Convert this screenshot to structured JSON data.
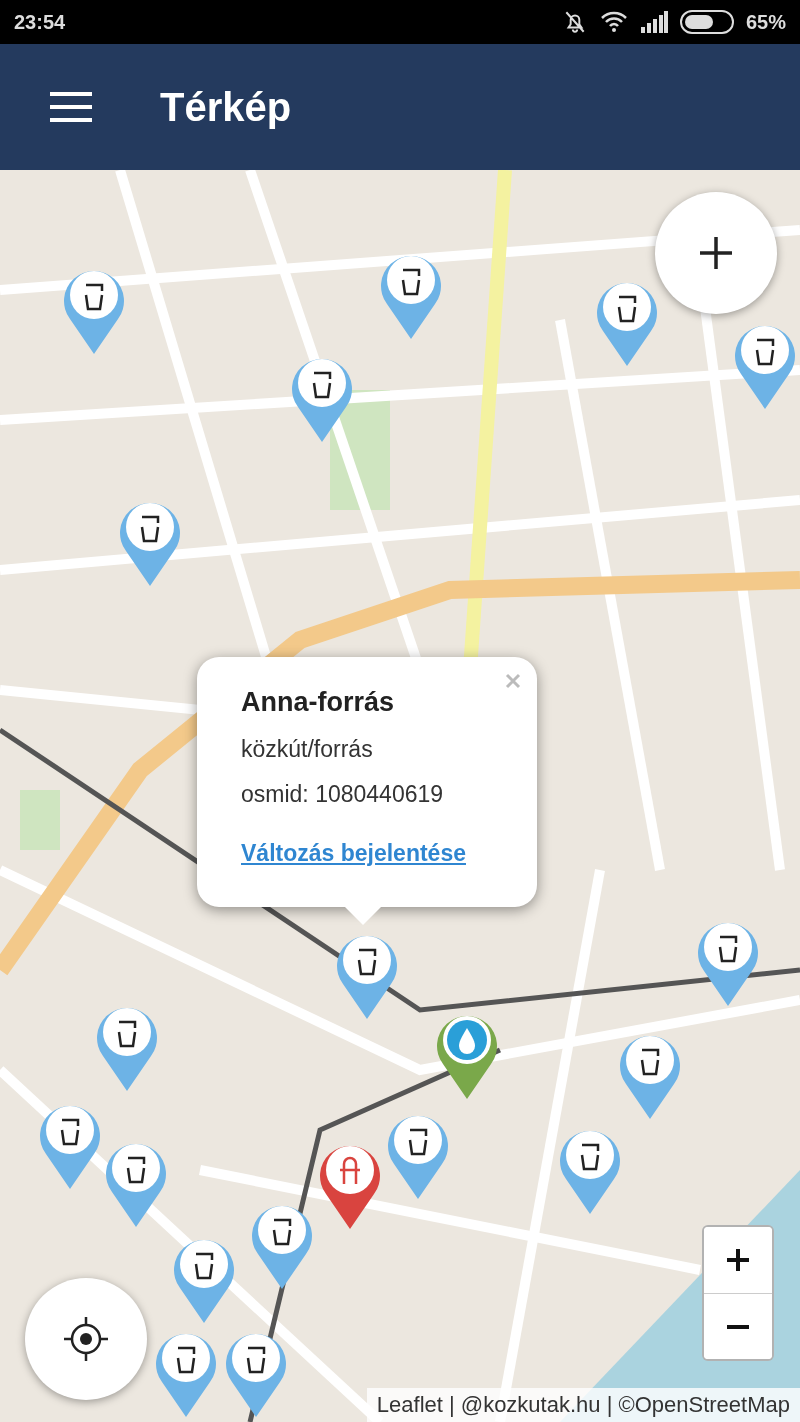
{
  "status_bar": {
    "time": "23:54",
    "battery": "65%"
  },
  "app_bar": {
    "title": "Térkép"
  },
  "popup": {
    "title": "Anna-forrás",
    "type": "közkút/forrás",
    "osmid": "osmid: 1080440619",
    "link": "Változás bejelentése"
  },
  "markers": [
    {
      "kind": "fountain"
    },
    {
      "kind": "fountain"
    },
    {
      "kind": "fountain"
    },
    {
      "kind": "fountain"
    },
    {
      "kind": "fountain"
    },
    {
      "kind": "fountain"
    },
    {
      "kind": "fountain"
    },
    {
      "kind": "fountain"
    },
    {
      "kind": "fountain"
    },
    {
      "kind": "fountain"
    },
    {
      "kind": "fountain"
    },
    {
      "kind": "fountain"
    },
    {
      "kind": "fountain"
    },
    {
      "kind": "fountain"
    },
    {
      "kind": "fountain"
    },
    {
      "kind": "fountain"
    },
    {
      "kind": "fountain"
    },
    {
      "kind": "fountain"
    },
    {
      "kind": "refill"
    },
    {
      "kind": "hydrant"
    }
  ],
  "attribution": "Leaflet | @kozkutak.hu | ©OpenStreetMap"
}
